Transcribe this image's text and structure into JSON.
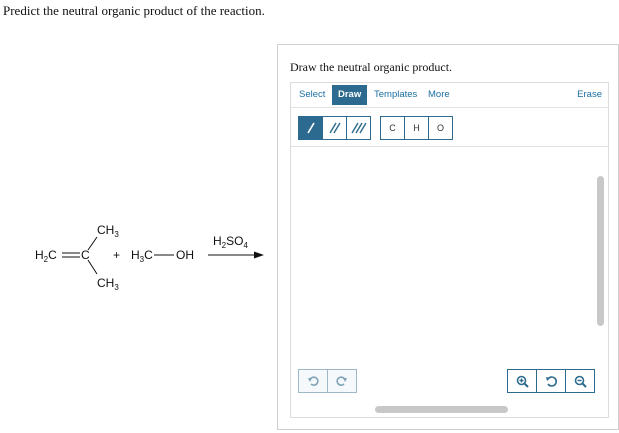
{
  "question": "Predict the neutral organic product of the reaction.",
  "reaction": {
    "reactant1": {
      "ch3_top_main": "CH",
      "ch3_top_sub": "3",
      "ch3_bottom_main": "CH",
      "ch3_bottom_sub": "3",
      "h2c_h": "H",
      "h2c_sub": "2",
      "h2c_c": "C",
      "c_center": "C"
    },
    "plus": "+",
    "reactant2": {
      "h3c_h": "H",
      "h3c_sub": "3",
      "h3c_c": "C",
      "oh": "OH"
    },
    "reagent": {
      "h": "H",
      "sub1": "2",
      "so": "SO",
      "sub2": "4"
    }
  },
  "panel": {
    "title": "Draw the neutral organic product.",
    "tabs": [
      "Select",
      "Draw",
      "Templates",
      "More"
    ],
    "active_tab": "Draw",
    "erase": "Erase",
    "atoms": [
      "C",
      "H",
      "O"
    ],
    "accent_color": "#2c6b8f",
    "link_color": "#1a6ea0"
  }
}
